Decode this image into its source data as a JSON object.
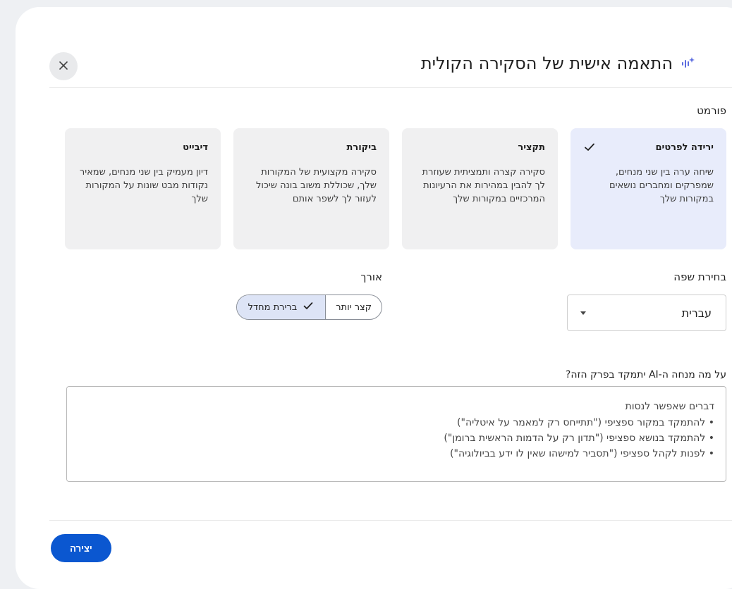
{
  "dialog": {
    "title": "התאמה אישית של הסקירה הקולית",
    "icon": "audio-spark-icon",
    "close_icon": "close-icon"
  },
  "format": {
    "label": "פורמט",
    "options": [
      {
        "title": "ירידה לפרטים",
        "desc": "שיחה ערה בין שני מנחים, שמפרקים ומחברים נושאים במקורות שלך",
        "selected": true
      },
      {
        "title": "תקציר",
        "desc": "סקירה קצרה ותמציתית שעוזרת לך להבין במהירות את הרעיונות המרכזיים במקורות שלך",
        "selected": false
      },
      {
        "title": "ביקורת",
        "desc": "סקירה מקצועית של המקורות שלך, שכוללת משוב בונה שיכול לעזור לך לשפר אותם",
        "selected": false
      },
      {
        "title": "דיבייט",
        "desc": "דיון מעמיק בין שני מנחים, שמאיר נקודות מבט שונות על המקורות שלך",
        "selected": false
      }
    ]
  },
  "language": {
    "label": "בחירת שפה",
    "value": "עברית"
  },
  "length": {
    "label": "אורך",
    "options": [
      {
        "label": "קצר יותר",
        "selected": false
      },
      {
        "label": "ברירת מחדל",
        "selected": true
      }
    ]
  },
  "focus": {
    "label": "על מה מנחה ה-AI יתמקד בפרק הזה?",
    "placeholder_head": "דברים שאפשר לנסות",
    "placeholder_items": [
      "להתמקד במקור ספציפי (\"תתייחס רק למאמר על איטליה\")",
      "להתמקד בנושא ספציפי (\"תדון רק על הדמות הראשית ברומן\")",
      "לפנות לקהל ספציפי (\"תסביר למישהו שאין לו ידע בביולוגיה\")"
    ]
  },
  "actions": {
    "create_label": "יצירה"
  },
  "colors": {
    "accent": "#0b57d0",
    "selected_card": "#e8ecfb",
    "card": "#f0f0f1"
  }
}
